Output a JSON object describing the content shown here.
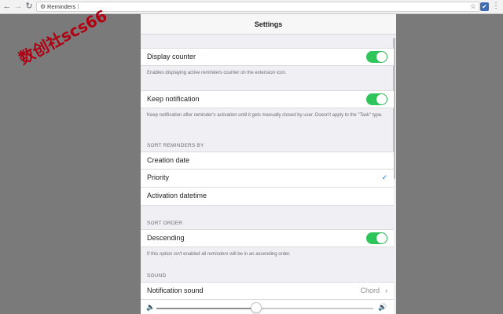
{
  "browser": {
    "back_icon": "arrow-left-icon",
    "forward_icon": "arrow-right-icon",
    "reload_icon": "reload-icon",
    "address_text": "Reminders",
    "star_icon": "star-icon",
    "extension_icon": "extension-icon",
    "menu_icon": "menu-icon"
  },
  "watermark": "数创社scs66",
  "settings": {
    "title": "Settings",
    "display_counter": {
      "label": "Display counter",
      "enabled": true,
      "description": "Enables displaying active reminders counter on the extension icon."
    },
    "keep_notification": {
      "label": "Keep notification",
      "enabled": true,
      "description": "Keep notification after reminder's activation until it gets manually closed by user. Doesn't apply to the \"Task\" type."
    },
    "sort_reminders": {
      "title": "SORT REMINDERS BY",
      "options": [
        {
          "label": "Creation date",
          "selected": false
        },
        {
          "label": "Priority",
          "selected": true
        },
        {
          "label": "Activation datetime",
          "selected": false
        }
      ],
      "check_mark": "✓"
    },
    "sort_order": {
      "title": "SORT ORDER",
      "descending_label": "Descending",
      "enabled": true,
      "description": "If this option isn't enabled all reminders will be in an ascending order."
    },
    "sound": {
      "title": "SOUND",
      "notification_sound_label": "Notification sound",
      "notification_sound_value": "Chord",
      "volume_fraction": 0.46
    }
  },
  "colors": {
    "toggle_on": "#2ec55a",
    "check": "#007aff",
    "watermark": "#b00012"
  }
}
